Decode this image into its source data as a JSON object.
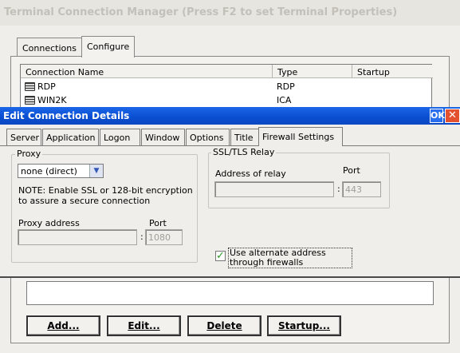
{
  "background_window": {
    "title": "Terminal Connection Manager (Press F2 to set Terminal Properties)",
    "tabs": [
      "Connections",
      "Configure"
    ],
    "columns": [
      "Connection Name",
      "Type",
      "Startup"
    ],
    "rows": [
      {
        "name": "RDP",
        "type": "RDP",
        "startup": "",
        "icon": "computer-icon"
      },
      {
        "name": "WIN2K",
        "type": "ICA",
        "startup": "",
        "icon": "computer-icon"
      }
    ],
    "buttons": {
      "add": "Add...",
      "edit": "Edit...",
      "delete": "Delete",
      "startup": "Startup..."
    }
  },
  "dialog": {
    "title": "Edit Connection Details",
    "ok_label": "OK",
    "close_label": "✕",
    "tabs": [
      "Server",
      "Application",
      "Logon",
      "Window",
      "Options",
      "Title",
      "Firewall Settings"
    ],
    "active_tab": "Firewall Settings",
    "proxy": {
      "group_label": "Proxy",
      "selected": "none (direct)",
      "note": "NOTE: Enable SSL or 128-bit encryption to assure a secure connection",
      "address_label": "Proxy address",
      "address_value": "",
      "port_label": "Port",
      "port_separator": ":",
      "port_value": "1080"
    },
    "relay": {
      "group_label": "SSL/TLS Relay",
      "address_label": "Address of relay",
      "address_value": "",
      "port_label": "Port",
      "port_separator": ":",
      "port_value": "443"
    },
    "alternate_address": {
      "label": "Use alternate address through firewalls",
      "checked": true
    }
  },
  "colors": {
    "titlebar": "#0a4ed0",
    "check": "#2a9a22",
    "close": "#e3512e"
  }
}
